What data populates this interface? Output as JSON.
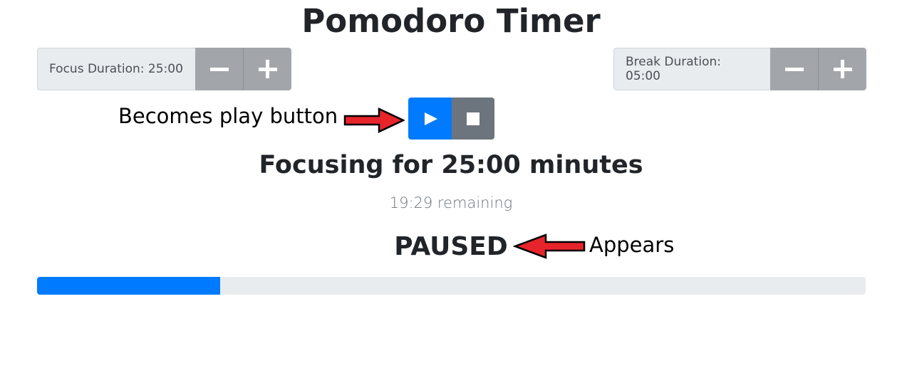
{
  "title": "Pomodoro Timer",
  "focus": {
    "label": "Focus Duration: 25:00",
    "decrement_icon": "minus-icon",
    "increment_icon": "plus-icon"
  },
  "break": {
    "label": "Break Duration: 05:00",
    "decrement_icon": "minus-icon",
    "increment_icon": "plus-icon"
  },
  "controls": {
    "play_icon": "play-icon",
    "stop_icon": "stop-icon"
  },
  "status": {
    "focusing_text": "Focusing for 25:00 minutes",
    "remaining_text": "19:29 remaining",
    "paused_text": "PAUSED"
  },
  "annotations": {
    "play_note": "Becomes play button",
    "paused_note": "Appears"
  },
  "progress": {
    "fraction": 0.221
  },
  "colors": {
    "primary": "#007bff",
    "secondary": "#6c757d",
    "button_gray": "#a2a6ab",
    "arrow_red": "#e8242b"
  }
}
